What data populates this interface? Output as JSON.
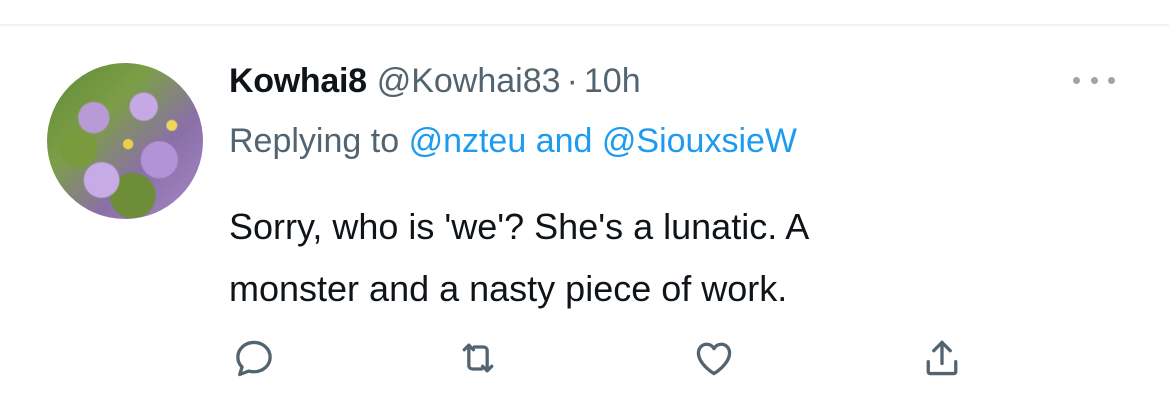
{
  "tweet": {
    "display_name": "Kowhai8",
    "handle": "@Kowhai83",
    "separator": "·",
    "time": "10h",
    "replying_prefix": "Replying to",
    "reply_mention_1": "@nzteu",
    "reply_conjunction": "and",
    "reply_mention_2": "@SiouxsieW",
    "text_line_1": "Sorry, who is 'we'? She's a lunatic. A",
    "text_line_2": "monster and a nasty piece of work."
  },
  "icons": {
    "more": "more-horizontal-icon",
    "reply": "reply-icon",
    "retweet": "retweet-icon",
    "like": "heart-icon",
    "share": "share-icon"
  },
  "colors": {
    "text": "#0f1419",
    "secondary": "#536471",
    "link": "#1d9bf0"
  }
}
